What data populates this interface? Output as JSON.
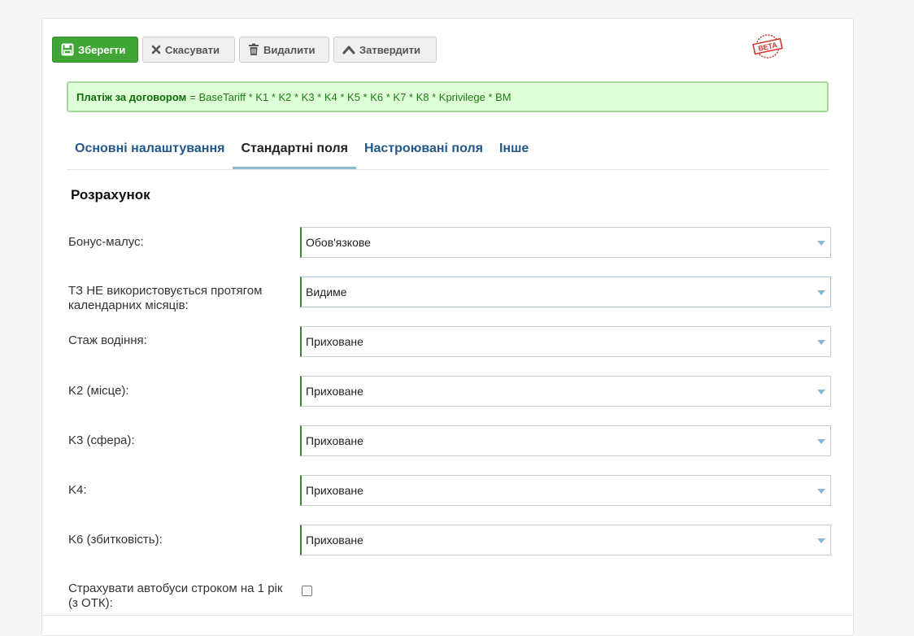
{
  "toolbar": {
    "save_label": "Зберегти",
    "cancel_label": "Скасувати",
    "delete_label": "Видалити",
    "approve_label": "Затвердити"
  },
  "beta_badge": "BETA",
  "formula": {
    "label": "Платіж за договором",
    "expression": "= BaseTariff * K1 * K2 * K3 * K4 * K5 * K6 * K7 * K8 * Kprivilege * BM"
  },
  "tabs": [
    {
      "label": "Основні налаштування",
      "active": false
    },
    {
      "label": "Стандартні поля",
      "active": true
    },
    {
      "label": "Настроювані поля",
      "active": false
    },
    {
      "label": "Інше",
      "active": false
    }
  ],
  "section_title": "Розрахунок",
  "fields": [
    {
      "label": "Бонус-малус:",
      "value": "Обов'язкове"
    },
    {
      "label": "ТЗ НЕ використовується протягом календарних місяців:",
      "value": "Видиме"
    },
    {
      "label": "Стаж водіння:",
      "value": "Приховане"
    },
    {
      "label": "K2 (місце):",
      "value": "Приховане"
    },
    {
      "label": "K3 (сфера):",
      "value": "Приховане"
    },
    {
      "label": "K4:",
      "value": "Приховане"
    },
    {
      "label": "K6 (збитковість):",
      "value": "Приховане"
    }
  ],
  "checkbox_field": {
    "label": "Страхувати автобуси строком на 1 рік (з ОТК):",
    "checked": false
  },
  "colors": {
    "primary": "#3fa535",
    "tab_link": "#23588a",
    "formula_bg": "#dfffd9"
  }
}
